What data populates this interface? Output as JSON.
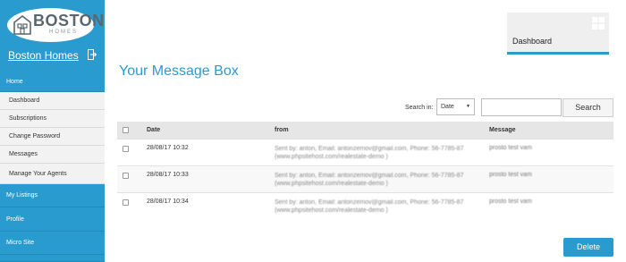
{
  "brand": {
    "name": "BOSTON",
    "tagline": "HOMES",
    "site_link": "Boston Homes"
  },
  "sidebar": {
    "sections": [
      {
        "label": "Home",
        "items": [
          "Dashboard",
          "Subscriptions",
          "Change Password",
          "Messages",
          "Manage Your Agents"
        ]
      },
      {
        "label": "My Listings"
      },
      {
        "label": "Profile"
      },
      {
        "label": "Micro Site"
      }
    ]
  },
  "dashboard_tile": {
    "label": "Dashboard"
  },
  "page": {
    "title": "Your Message Box"
  },
  "search": {
    "label": "Search in:",
    "field_selected": "Date",
    "input_value": "",
    "button_label": "Search"
  },
  "table": {
    "headers": {
      "date": "Date",
      "from": "from",
      "message": "Message"
    },
    "rows": [
      {
        "date": "28/08/17 10:32",
        "from_line1": "Sent by: anton, Email: antonzemov@gmail.com, Phone: 56-7785-87",
        "from_line2": "(www.phpsitehost.com/realestate-demo )",
        "message": "prosto test vam"
      },
      {
        "date": "28/08/17 10:33",
        "from_line1": "Sent by: anton, Email: antonzemov@gmail.com, Phone: 56-7785-87",
        "from_line2": "(www.phpsitehost.com/realestate-demo )",
        "message": "prosto test vam"
      },
      {
        "date": "28/08/17 10:34",
        "from_line1": "Sent by: anton, Email: antonzemov@gmail.com, Phone: 56-7785-87",
        "from_line2": "(www.phpsitehost.com/realestate-demo )",
        "message": "prosto test vam"
      }
    ]
  },
  "actions": {
    "delete_label": "Delete"
  },
  "colors": {
    "accent": "#2a9bcf",
    "sidebar_bg": "#f2f2f2",
    "header_bg": "#e6e6e6"
  },
  "icons": {
    "logo": "house-icon",
    "logout": "logout-icon",
    "tile": "windows-icon"
  }
}
